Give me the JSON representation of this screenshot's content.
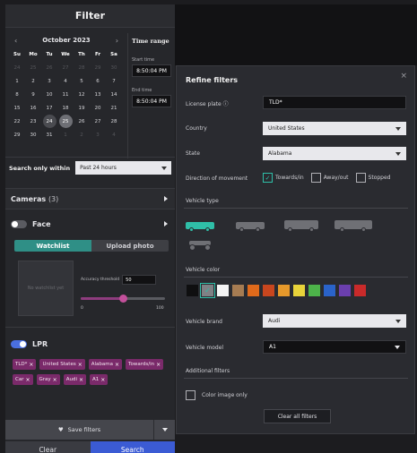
{
  "filter": {
    "title": "Filter",
    "calendar": {
      "month_label": "October 2023",
      "prev_arrow": "‹",
      "next_arrow": "›",
      "days_of_week": [
        "Su",
        "Mo",
        "Tu",
        "We",
        "Th",
        "Fr",
        "Sa"
      ],
      "weeks": [
        [
          [
            "24",
            "muted"
          ],
          [
            "25",
            "muted"
          ],
          [
            "26",
            "muted"
          ],
          [
            "27",
            "muted"
          ],
          [
            "28",
            "muted"
          ],
          [
            "29",
            "muted"
          ],
          [
            "30",
            "muted"
          ]
        ],
        [
          [
            "1",
            ""
          ],
          [
            "2",
            ""
          ],
          [
            "3",
            ""
          ],
          [
            "4",
            ""
          ],
          [
            "5",
            ""
          ],
          [
            "6",
            ""
          ],
          [
            "7",
            ""
          ]
        ],
        [
          [
            "8",
            ""
          ],
          [
            "9",
            ""
          ],
          [
            "10",
            ""
          ],
          [
            "11",
            ""
          ],
          [
            "12",
            ""
          ],
          [
            "13",
            ""
          ],
          [
            "14",
            ""
          ]
        ],
        [
          [
            "15",
            ""
          ],
          [
            "16",
            ""
          ],
          [
            "17",
            ""
          ],
          [
            "18",
            ""
          ],
          [
            "19",
            ""
          ],
          [
            "20",
            ""
          ],
          [
            "21",
            ""
          ]
        ],
        [
          [
            "22",
            ""
          ],
          [
            "23",
            ""
          ],
          [
            "24",
            "range"
          ],
          [
            "25",
            "sel"
          ],
          [
            "26",
            ""
          ],
          [
            "27",
            ""
          ],
          [
            "28",
            ""
          ]
        ],
        [
          [
            "29",
            ""
          ],
          [
            "30",
            ""
          ],
          [
            "31",
            ""
          ],
          [
            "1",
            "muted"
          ],
          [
            "2",
            "muted"
          ],
          [
            "3",
            "muted"
          ],
          [
            "4",
            "muted"
          ]
        ]
      ]
    },
    "time_range": {
      "title": "Time range",
      "start_label": "Start time",
      "start_value": "8:50:04 PM",
      "end_label": "End time",
      "end_value": "8:50:04 PM"
    },
    "search_within": {
      "label": "Search only within",
      "value": "Past 24 hours"
    },
    "cameras": {
      "label": "Cameras",
      "count": "(3)"
    },
    "face": {
      "label": "Face",
      "enabled": false,
      "tabs": [
        "Watchlist",
        "Upload photo"
      ],
      "watchlist_placeholder": "No watchlist yet",
      "accuracy_label": "Accuracy threshold",
      "accuracy_value": "50",
      "slider_min": "0",
      "slider_max": "100",
      "slider_fraction": 0.5
    },
    "lpr": {
      "label": "LPR",
      "enabled": true,
      "chips": [
        "TLD*",
        "United States",
        "Alabama",
        "Towards/in",
        "Car",
        "Gray",
        "Audi",
        "A1"
      ]
    },
    "save_label": "Save filters",
    "clear_label": "Clear",
    "search_label": "Search"
  },
  "refine": {
    "title": "Refine filters",
    "close": "×",
    "license_plate": {
      "label": "License plate ⓘ",
      "value": "TLD*"
    },
    "country": {
      "label": "Country",
      "value": "United States"
    },
    "state": {
      "label": "State",
      "value": "Alabama"
    },
    "direction": {
      "label": "Direction of movement",
      "options": [
        {
          "label": "Towards/in",
          "checked": true
        },
        {
          "label": "Away/out",
          "checked": false
        },
        {
          "label": "Stopped",
          "checked": false
        }
      ]
    },
    "vehicle_type_label": "Vehicle type",
    "vehicle_color_label": "Vehicle color",
    "colors": [
      "#0f0f10",
      "#7f8185",
      "#f4f4f4",
      "#a67c52",
      "#e06a1b",
      "#c8461e",
      "#e6992b",
      "#e8d33a",
      "#4db34a",
      "#2a63c9",
      "#6b3fae",
      "#c92a2a"
    ],
    "selected_color_index": 1,
    "vehicle_brand": {
      "label": "Vehicle brand",
      "value": "Audi"
    },
    "vehicle_model": {
      "label": "Vehicle model",
      "value": "A1"
    },
    "additional_label": "Additional filters",
    "color_image_only": "Color image only",
    "clear_all": "Clear all filters"
  }
}
